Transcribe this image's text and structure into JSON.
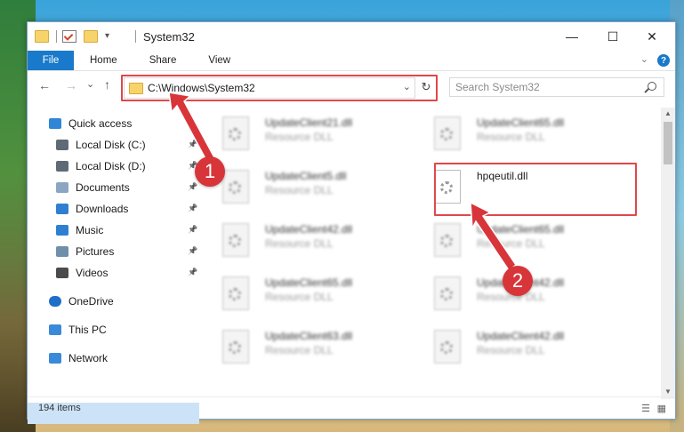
{
  "window": {
    "title": "System32",
    "controls": {
      "minimize": "—",
      "maximize": "☐",
      "close": "✕"
    }
  },
  "ribbon": {
    "tabs": [
      "File",
      "Home",
      "Share",
      "View"
    ],
    "help": "?"
  },
  "nav": {
    "back": "←",
    "forward": "→",
    "recent": "⌄",
    "up": "↑",
    "address": "C:\\Windows\\System32",
    "refresh": "↻",
    "search_placeholder": "Search System32"
  },
  "sidebar": {
    "items": [
      {
        "label": "Quick access",
        "icon": "star-icon"
      },
      {
        "label": "Local Disk (C:)",
        "icon": "drive-icon",
        "pinned": true
      },
      {
        "label": "Local Disk (D:)",
        "icon": "drive-icon",
        "pinned": true
      },
      {
        "label": "Documents",
        "icon": "documents-icon",
        "pinned": true
      },
      {
        "label": "Downloads",
        "icon": "downloads-icon",
        "pinned": true
      },
      {
        "label": "Music",
        "icon": "music-icon",
        "pinned": true
      },
      {
        "label": "Pictures",
        "icon": "pictures-icon",
        "pinned": true
      },
      {
        "label": "Videos",
        "icon": "videos-icon",
        "pinned": true
      },
      {
        "label": "OneDrive",
        "icon": "cloud-icon"
      },
      {
        "label": "This PC",
        "icon": "computer-icon",
        "selected": true
      },
      {
        "label": "Network",
        "icon": "network-icon"
      }
    ]
  },
  "files": [
    {
      "name": "UpdateClient21.dll",
      "type": "Resource DLL"
    },
    {
      "name": "UpdateClient65.dll",
      "type": "Resource DLL"
    },
    {
      "name": "UpdateClient5.dll",
      "type": "Resource DLL"
    },
    {
      "name": "hpqeutil.dll",
      "type": "",
      "highlighted": true
    },
    {
      "name": "UpdateClient42.dll",
      "type": "Resource DLL"
    },
    {
      "name": "UpdateClient65.dll",
      "type": "Resource DLL"
    },
    {
      "name": "UpdateClient65.dll",
      "type": "Resource DLL"
    },
    {
      "name": "UpdateClient42.dll",
      "type": "Resource DLL"
    },
    {
      "name": "UpdateClient63.dll",
      "type": "Resource DLL"
    },
    {
      "name": "UpdateClient42.dll",
      "type": "Resource DLL"
    }
  ],
  "status": {
    "count": "194 items"
  },
  "annotations": {
    "step1": "1",
    "step2": "2",
    "color": "#d8353a"
  }
}
